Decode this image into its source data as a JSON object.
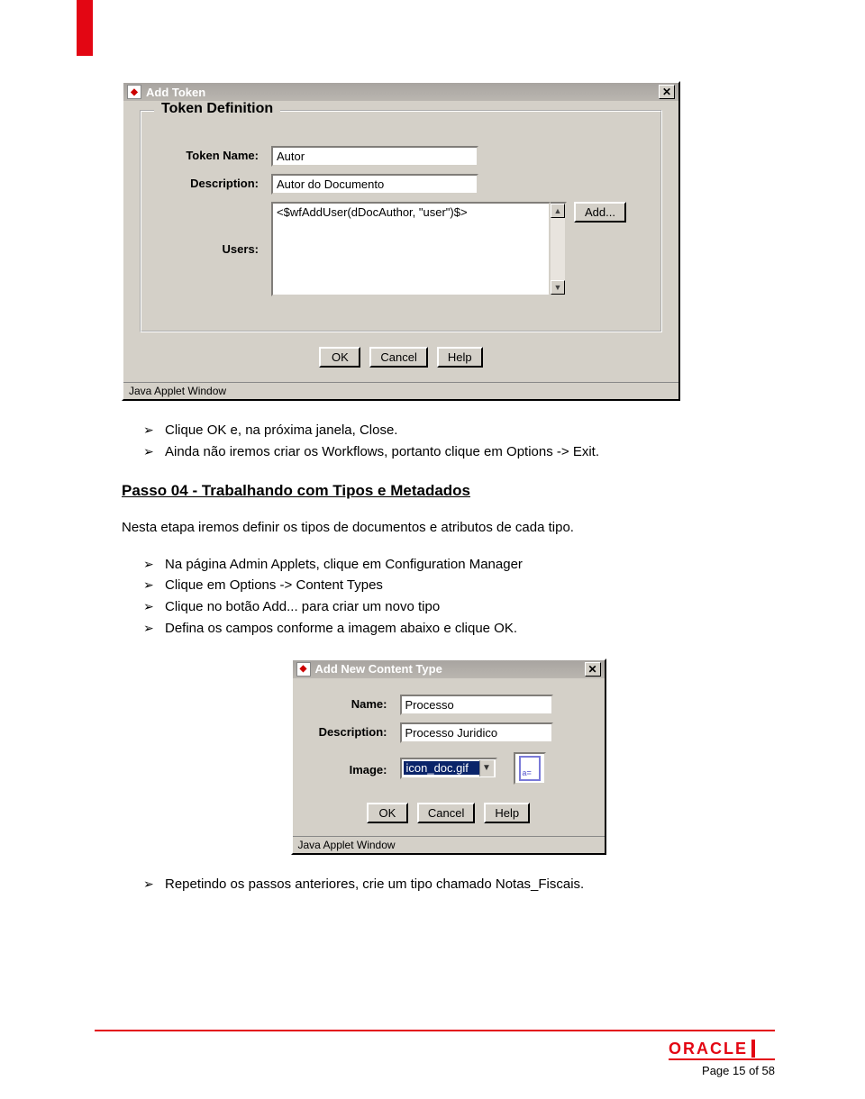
{
  "dialog1": {
    "title": "Add Token",
    "group_title": "Token Definition",
    "token_name_label": "Token Name:",
    "token_name_value": "Autor",
    "description_label": "Description:",
    "description_value": "Autor do Documento",
    "users_label": "Users:",
    "users_value": "<$wfAddUser(dDocAuthor, \"user\")$>",
    "add_btn": "Add...",
    "ok_btn": "OK",
    "cancel_btn": "Cancel",
    "help_btn": "Help",
    "status": "Java Applet Window"
  },
  "bullets_after_d1": [
    "Clique OK e, na próxima janela, Close.",
    "Ainda não iremos criar os Workflows, portanto clique em Options -> Exit."
  ],
  "step_heading": "Passo 04 - Trabalhando com Tipos e Metadados",
  "step_para": "Nesta etapa iremos definir os tipos de documentos e atributos de cada tipo.",
  "bullets_instr": [
    "Na página Admin Applets, clique em Configuration Manager",
    "Clique em Options -> Content Types",
    "Clique no botão Add... para criar um novo tipo",
    "Defina os campos conforme a imagem abaixo e clique OK."
  ],
  "dialog2": {
    "title": "Add New Content Type",
    "name_label": "Name:",
    "name_value": "Processo",
    "description_label": "Description:",
    "description_value": "Processo Juridico",
    "image_label": "Image:",
    "image_value": "icon_doc.gif",
    "ok_btn": "OK",
    "cancel_btn": "Cancel",
    "help_btn": "Help",
    "status": "Java Applet Window"
  },
  "bullets_after_d2": [
    "Repetindo os passos anteriores, crie um tipo chamado Notas_Fiscais."
  ],
  "footer": {
    "logo": "ORACLE",
    "page": "Page 15 of 58"
  }
}
